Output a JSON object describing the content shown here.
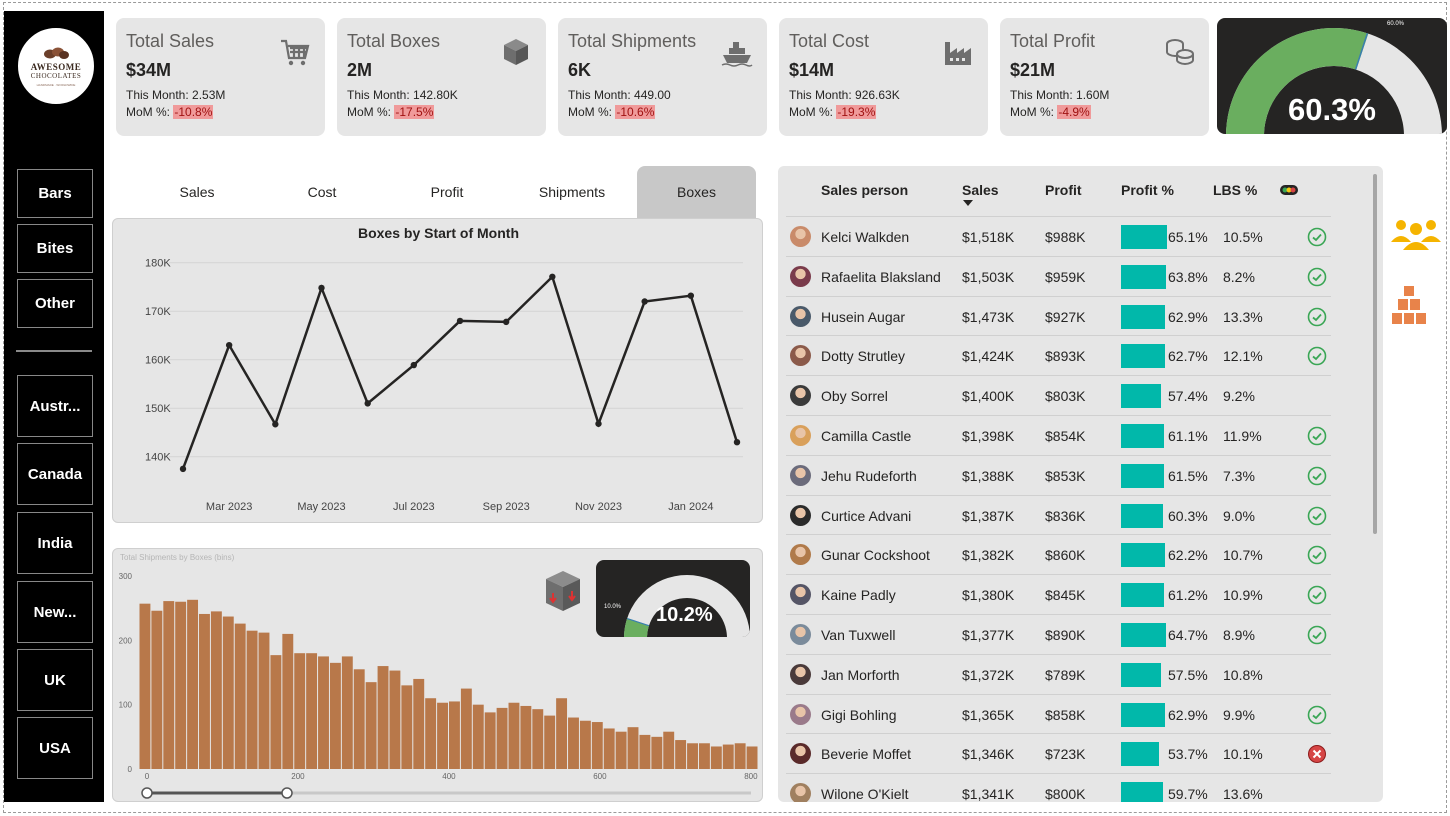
{
  "logo": {
    "line1": "AWESOME",
    "line2": "CHOCOLATES",
    "line3": "HANDMADE · WORLDWIDE"
  },
  "nav": {
    "products": [
      "Bars",
      "Bites",
      "Other"
    ],
    "countries": [
      "Austr...",
      "Canada",
      "India",
      "New...",
      "UK",
      "USA"
    ]
  },
  "kpis": [
    {
      "title": "Total Sales",
      "value": "$34M",
      "this_month": "This Month: 2.53M",
      "mom_label": "MoM %:",
      "mom": "-10.8%",
      "icon": "cart-icon"
    },
    {
      "title": "Total Boxes",
      "value": "2M",
      "this_month": "This Month: 142.80K",
      "mom_label": "MoM %:",
      "mom": "-17.5%",
      "icon": "box-icon"
    },
    {
      "title": "Total Shipments",
      "value": "6K",
      "this_month": "This Month: 449.00",
      "mom_label": "MoM %:",
      "mom": "-10.6%",
      "icon": "ship-icon"
    },
    {
      "title": "Total Cost",
      "value": "$14M",
      "this_month": "This Month: 926.63K",
      "mom_label": "MoM %:",
      "mom": "-19.3%",
      "icon": "factory-icon"
    },
    {
      "title": "Total Profit",
      "value": "$21M",
      "this_month": "This Month: 1.60M",
      "mom_label": "MoM %:",
      "mom": "-4.9%",
      "icon": "coins-icon"
    }
  ],
  "profit_gauge": {
    "value_label": "60.3%",
    "marker_label": "60.0%",
    "value": 0.603,
    "target": 0.6,
    "fill_color": "#6aae5f",
    "track_color": "#e6e6e6"
  },
  "tabs": {
    "items": [
      "Sales",
      "Cost",
      "Profit",
      "Shipments",
      "Boxes"
    ],
    "selected": "Boxes"
  },
  "chart_data": [
    {
      "type": "line",
      "title": "Boxes by Start of Month",
      "x": [
        "Feb 2023",
        "Mar 2023",
        "Apr 2023",
        "May 2023",
        "Jun 2023",
        "Jul 2023",
        "Aug 2023",
        "Sep 2023",
        "Oct 2023",
        "Nov 2023",
        "Dec 2023",
        "Jan 2024",
        "Feb 2024"
      ],
      "x_tick_labels": [
        "Mar 2023",
        "May 2023",
        "Jul 2023",
        "Sep 2023",
        "Nov 2023",
        "Jan 2024"
      ],
      "values": [
        137500,
        163000,
        146700,
        174800,
        151000,
        158900,
        168000,
        167800,
        177100,
        146800,
        172000,
        173200,
        143000
      ],
      "y_tick_labels": [
        "140K",
        "150K",
        "160K",
        "170K",
        "180K"
      ],
      "ylim": [
        135000,
        182000
      ],
      "grid": true,
      "color": "#252423"
    },
    {
      "type": "bar",
      "title": "Total Shipments by Boxes (bins)",
      "x_tick_labels": [
        "0",
        "200",
        "400",
        "600",
        "800"
      ],
      "y_tick_labels": [
        "0",
        "100",
        "200",
        "300"
      ],
      "xlim": [
        0,
        820
      ],
      "ylim": [
        0,
        300
      ],
      "bin_width": 20,
      "values": [
        257,
        246,
        261,
        260,
        263,
        241,
        245,
        237,
        226,
        215,
        212,
        177,
        210,
        180,
        180,
        175,
        165,
        175,
        155,
        135,
        160,
        153,
        130,
        140,
        110,
        103,
        105,
        125,
        100,
        88,
        95,
        103,
        98,
        93,
        83,
        110,
        80,
        75,
        73,
        63,
        58,
        65,
        53,
        50,
        58,
        45,
        40,
        40,
        35,
        38,
        40,
        35
      ],
      "color": "#b8784a"
    }
  ],
  "ship_gauge": {
    "value_label": "10.2%",
    "marker_label": "10.0%",
    "value": 0.102,
    "target": 0.1,
    "fill_color": "#6aae5f",
    "track_color": "#e6e6e6"
  },
  "table": {
    "headers": {
      "person": "Sales person",
      "sales": "Sales",
      "profit": "Profit",
      "profit_pct": "Profit %",
      "lbs_pct": "LBS %"
    },
    "rows": [
      {
        "name": "Kelci Walkden",
        "sales": "$1,518K",
        "profit": "$988K",
        "profit_pct": "65.1%",
        "pct": 0.651,
        "lbs": "10.5%",
        "status": "check"
      },
      {
        "name": "Rafaelita Blaksland",
        "sales": "$1,503K",
        "profit": "$959K",
        "profit_pct": "63.8%",
        "pct": 0.638,
        "lbs": "8.2%",
        "status": "check"
      },
      {
        "name": "Husein Augar",
        "sales": "$1,473K",
        "profit": "$927K",
        "profit_pct": "62.9%",
        "pct": 0.629,
        "lbs": "13.3%",
        "status": "check"
      },
      {
        "name": "Dotty Strutley",
        "sales": "$1,424K",
        "profit": "$893K",
        "profit_pct": "62.7%",
        "pct": 0.627,
        "lbs": "12.1%",
        "status": "check"
      },
      {
        "name": "Oby Sorrel",
        "sales": "$1,400K",
        "profit": "$803K",
        "profit_pct": "57.4%",
        "pct": 0.574,
        "lbs": "9.2%",
        "status": ""
      },
      {
        "name": "Camilla Castle",
        "sales": "$1,398K",
        "profit": "$854K",
        "profit_pct": "61.1%",
        "pct": 0.611,
        "lbs": "11.9%",
        "status": "check"
      },
      {
        "name": "Jehu Rudeforth",
        "sales": "$1,388K",
        "profit": "$853K",
        "profit_pct": "61.5%",
        "pct": 0.615,
        "lbs": "7.3%",
        "status": "check"
      },
      {
        "name": "Curtice Advani",
        "sales": "$1,387K",
        "profit": "$836K",
        "profit_pct": "60.3%",
        "pct": 0.603,
        "lbs": "9.0%",
        "status": "check"
      },
      {
        "name": "Gunar Cockshoot",
        "sales": "$1,382K",
        "profit": "$860K",
        "profit_pct": "62.2%",
        "pct": 0.622,
        "lbs": "10.7%",
        "status": "check"
      },
      {
        "name": "Kaine Padly",
        "sales": "$1,380K",
        "profit": "$845K",
        "profit_pct": "61.2%",
        "pct": 0.612,
        "lbs": "10.9%",
        "status": "check"
      },
      {
        "name": "Van Tuxwell",
        "sales": "$1,377K",
        "profit": "$890K",
        "profit_pct": "64.7%",
        "pct": 0.647,
        "lbs": "8.9%",
        "status": "check"
      },
      {
        "name": "Jan Morforth",
        "sales": "$1,372K",
        "profit": "$789K",
        "profit_pct": "57.5%",
        "pct": 0.575,
        "lbs": "10.8%",
        "status": ""
      },
      {
        "name": "Gigi Bohling",
        "sales": "$1,365K",
        "profit": "$858K",
        "profit_pct": "62.9%",
        "pct": 0.629,
        "lbs": "9.9%",
        "status": "check"
      },
      {
        "name": "Beverie Moffet",
        "sales": "$1,346K",
        "profit": "$723K",
        "profit_pct": "53.7%",
        "pct": 0.537,
        "lbs": "10.1%",
        "status": "cross"
      },
      {
        "name": "Wilone O'Kielt",
        "sales": "$1,341K",
        "profit": "$800K",
        "profit_pct": "59.7%",
        "pct": 0.597,
        "lbs": "13.6%",
        "status": ""
      }
    ]
  },
  "colors": {
    "teal_bar": "#01b8aa",
    "check_green": "#3aa655",
    "cross_red": "#d64545",
    "people_icon": "#f5b400",
    "boxes_icon": "#e8834a"
  },
  "side_icons": [
    "people-icon",
    "boxes-stack-icon"
  ]
}
